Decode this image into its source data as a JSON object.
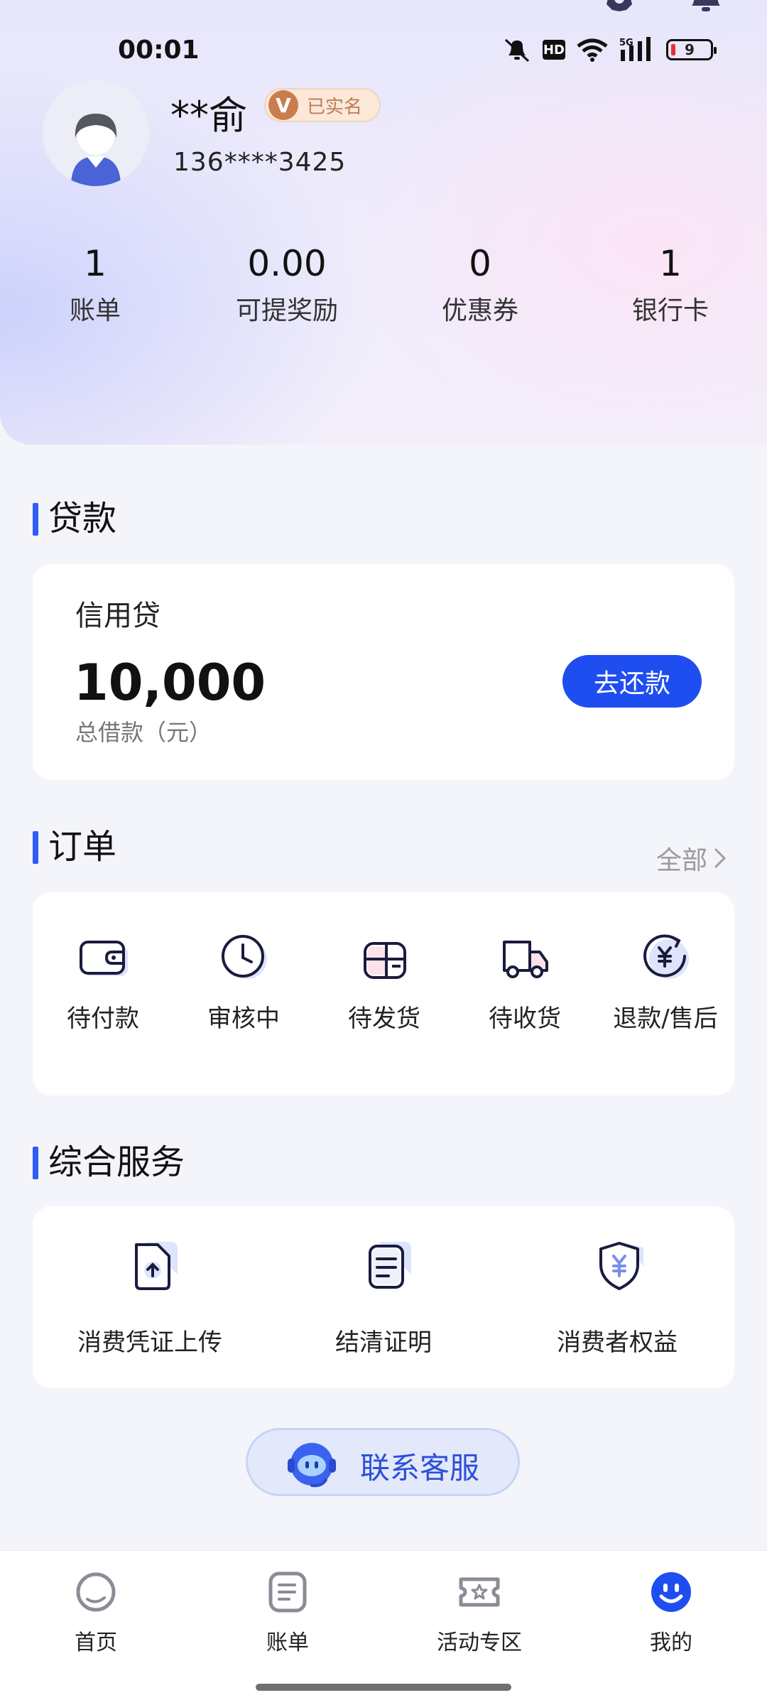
{
  "status_bar": {
    "time": "00:01",
    "hd": "HD",
    "network": "5G",
    "battery": "9"
  },
  "profile": {
    "name": "**俞",
    "verified_badge": {
      "letter": "V",
      "text": "已实名"
    },
    "phone": "136****3425"
  },
  "stats": [
    {
      "value": "1",
      "label": "账单"
    },
    {
      "value": "0.00",
      "label": "可提奖励"
    },
    {
      "value": "0",
      "label": "优惠券"
    },
    {
      "value": "1",
      "label": "银行卡"
    }
  ],
  "loan": {
    "section_title": "贷款",
    "card_title": "信用贷",
    "amount": "10,000",
    "amount_label": "总借款（元）",
    "repay_button": "去还款"
  },
  "orders": {
    "section_title": "订单",
    "more_label": "全部",
    "items": [
      {
        "label": "待付款",
        "icon": "wallet-icon"
      },
      {
        "label": "审核中",
        "icon": "clock-icon"
      },
      {
        "label": "待发货",
        "icon": "package-icon"
      },
      {
        "label": "待收货",
        "icon": "truck-icon"
      },
      {
        "label": "退款/售后",
        "icon": "refund-icon"
      }
    ]
  },
  "services": {
    "section_title": "综合服务",
    "items": [
      {
        "label": "消费凭证上传",
        "icon": "upload-document-icon"
      },
      {
        "label": "结清证明",
        "icon": "certificate-icon"
      },
      {
        "label": "消费者权益",
        "icon": "shield-yuan-icon"
      }
    ]
  },
  "contact": {
    "label": "联系客服",
    "icon": "customer-service-bot-icon"
  },
  "tabs": [
    {
      "label": "首页",
      "icon": "home-icon",
      "active": false
    },
    {
      "label": "账单",
      "icon": "bill-icon",
      "active": false
    },
    {
      "label": "活动专区",
      "icon": "ticket-star-icon",
      "active": false
    },
    {
      "label": "我的",
      "icon": "smile-icon",
      "active": true
    }
  ],
  "colors": {
    "accent": "#1f4ef0",
    "section_bar": "#2f5cf3",
    "icon_dark": "#1a1c3d",
    "icon_light": "#dde4fb"
  }
}
